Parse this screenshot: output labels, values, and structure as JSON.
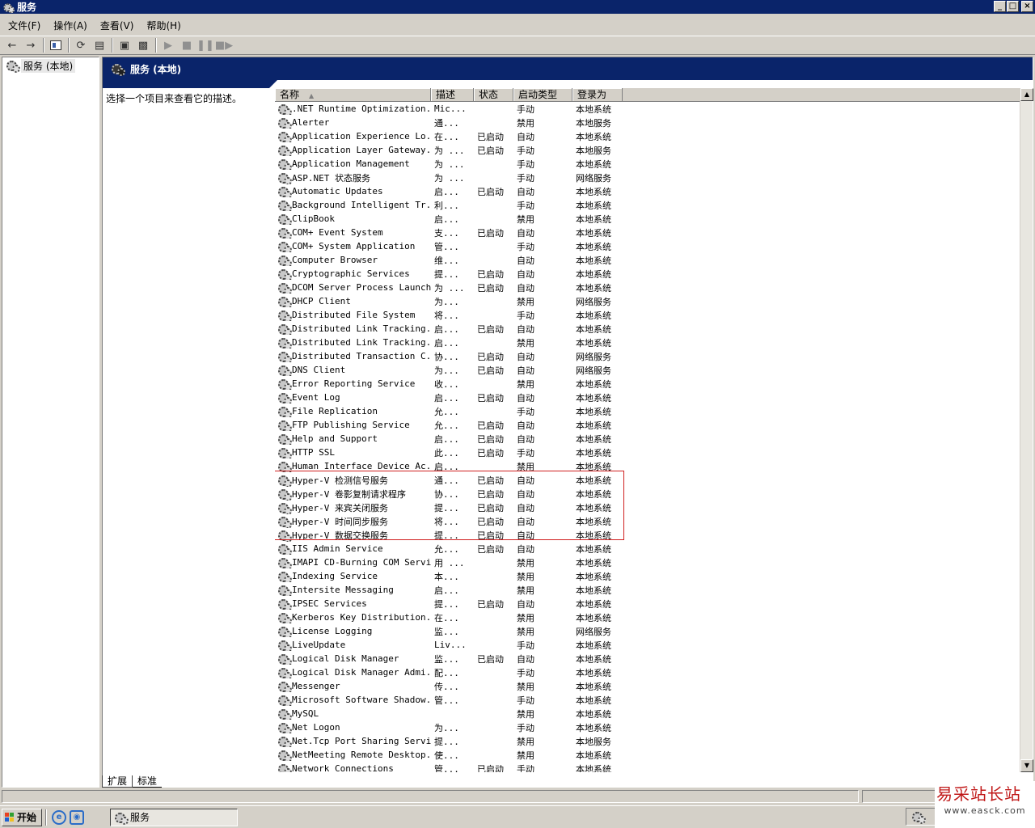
{
  "window": {
    "title": "服务",
    "min_label": "_",
    "max_label": "□",
    "close_label": "×"
  },
  "menu": [
    "文件(F)",
    "操作(A)",
    "查看(V)",
    "帮助(H)"
  ],
  "tree": {
    "root_label": "服务 (本地)"
  },
  "panel": {
    "header_title": "服务 (本地)",
    "description_prompt": "选择一个项目来查看它的描述。"
  },
  "columns": {
    "name": "名称",
    "desc": "描述",
    "status": "状态",
    "startup": "启动类型",
    "logon": "登录为"
  },
  "services": [
    {
      "name": ".NET Runtime Optimization...",
      "desc": "Mic...",
      "status": "",
      "startup": "手动",
      "logon": "本地系统"
    },
    {
      "name": "Alerter",
      "desc": "通...",
      "status": "",
      "startup": "禁用",
      "logon": "本地服务"
    },
    {
      "name": "Application Experience Lo...",
      "desc": "在...",
      "status": "已启动",
      "startup": "自动",
      "logon": "本地系统"
    },
    {
      "name": "Application Layer Gateway...",
      "desc": "为 ...",
      "status": "已启动",
      "startup": "手动",
      "logon": "本地服务"
    },
    {
      "name": "Application Management",
      "desc": "为 ...",
      "status": "",
      "startup": "手动",
      "logon": "本地系统"
    },
    {
      "name": "ASP.NET 状态服务",
      "desc": "为 ...",
      "status": "",
      "startup": "手动",
      "logon": "网络服务"
    },
    {
      "name": "Automatic Updates",
      "desc": "启...",
      "status": "已启动",
      "startup": "自动",
      "logon": "本地系统"
    },
    {
      "name": "Background Intelligent Tr...",
      "desc": "利...",
      "status": "",
      "startup": "手动",
      "logon": "本地系统"
    },
    {
      "name": "ClipBook",
      "desc": "启...",
      "status": "",
      "startup": "禁用",
      "logon": "本地系统"
    },
    {
      "name": "COM+ Event System",
      "desc": "支...",
      "status": "已启动",
      "startup": "自动",
      "logon": "本地系统"
    },
    {
      "name": "COM+ System Application",
      "desc": "管...",
      "status": "",
      "startup": "手动",
      "logon": "本地系统"
    },
    {
      "name": "Computer Browser",
      "desc": "维...",
      "status": "",
      "startup": "自动",
      "logon": "本地系统"
    },
    {
      "name": "Cryptographic Services",
      "desc": "提...",
      "status": "已启动",
      "startup": "自动",
      "logon": "本地系统"
    },
    {
      "name": "DCOM Server Process Launcher",
      "desc": "为 ...",
      "status": "已启动",
      "startup": "自动",
      "logon": "本地系统"
    },
    {
      "name": "DHCP Client",
      "desc": "为...",
      "status": "",
      "startup": "禁用",
      "logon": "网络服务"
    },
    {
      "name": "Distributed File System",
      "desc": "将...",
      "status": "",
      "startup": "手动",
      "logon": "本地系统"
    },
    {
      "name": "Distributed Link Tracking...",
      "desc": "启...",
      "status": "已启动",
      "startup": "自动",
      "logon": "本地系统"
    },
    {
      "name": "Distributed Link Tracking...",
      "desc": "启...",
      "status": "",
      "startup": "禁用",
      "logon": "本地系统"
    },
    {
      "name": "Distributed Transaction C...",
      "desc": "协...",
      "status": "已启动",
      "startup": "自动",
      "logon": "网络服务"
    },
    {
      "name": "DNS Client",
      "desc": "为...",
      "status": "已启动",
      "startup": "自动",
      "logon": "网络服务"
    },
    {
      "name": "Error Reporting Service",
      "desc": "收...",
      "status": "",
      "startup": "禁用",
      "logon": "本地系统"
    },
    {
      "name": "Event Log",
      "desc": "启...",
      "status": "已启动",
      "startup": "自动",
      "logon": "本地系统"
    },
    {
      "name": "File Replication",
      "desc": "允...",
      "status": "",
      "startup": "手动",
      "logon": "本地系统"
    },
    {
      "name": "FTP Publishing Service",
      "desc": "允...",
      "status": "已启动",
      "startup": "自动",
      "logon": "本地系统"
    },
    {
      "name": "Help and Support",
      "desc": "启...",
      "status": "已启动",
      "startup": "自动",
      "logon": "本地系统"
    },
    {
      "name": "HTTP SSL",
      "desc": "此...",
      "status": "已启动",
      "startup": "手动",
      "logon": "本地系统"
    },
    {
      "name": "Human Interface Device Ac...",
      "desc": "启...",
      "status": "",
      "startup": "禁用",
      "logon": "本地系统"
    },
    {
      "name": "Hyper-V 检测信号服务",
      "desc": "通...",
      "status": "已启动",
      "startup": "自动",
      "logon": "本地系统"
    },
    {
      "name": "Hyper-V 卷影复制请求程序",
      "desc": "协...",
      "status": "已启动",
      "startup": "自动",
      "logon": "本地系统"
    },
    {
      "name": "Hyper-V 来宾关闭服务",
      "desc": "提...",
      "status": "已启动",
      "startup": "自动",
      "logon": "本地系统"
    },
    {
      "name": "Hyper-V 时间同步服务",
      "desc": "将...",
      "status": "已启动",
      "startup": "自动",
      "logon": "本地系统"
    },
    {
      "name": "Hyper-V 数据交换服务",
      "desc": "提...",
      "status": "已启动",
      "startup": "自动",
      "logon": "本地系统"
    },
    {
      "name": "IIS Admin Service",
      "desc": "允...",
      "status": "已启动",
      "startup": "自动",
      "logon": "本地系统"
    },
    {
      "name": "IMAPI CD-Burning COM Service",
      "desc": "用 ...",
      "status": "",
      "startup": "禁用",
      "logon": "本地系统"
    },
    {
      "name": "Indexing Service",
      "desc": "本...",
      "status": "",
      "startup": "禁用",
      "logon": "本地系统"
    },
    {
      "name": "Intersite Messaging",
      "desc": "启...",
      "status": "",
      "startup": "禁用",
      "logon": "本地系统"
    },
    {
      "name": "IPSEC Services",
      "desc": "提...",
      "status": "已启动",
      "startup": "自动",
      "logon": "本地系统"
    },
    {
      "name": "Kerberos Key Distribution...",
      "desc": "在...",
      "status": "",
      "startup": "禁用",
      "logon": "本地系统"
    },
    {
      "name": "License Logging",
      "desc": "监...",
      "status": "",
      "startup": "禁用",
      "logon": "网络服务"
    },
    {
      "name": "LiveUpdate",
      "desc": "Liv...",
      "status": "",
      "startup": "手动",
      "logon": "本地系统"
    },
    {
      "name": "Logical Disk Manager",
      "desc": "监...",
      "status": "已启动",
      "startup": "自动",
      "logon": "本地系统"
    },
    {
      "name": "Logical Disk Manager Admi...",
      "desc": "配...",
      "status": "",
      "startup": "手动",
      "logon": "本地系统"
    },
    {
      "name": "Messenger",
      "desc": "传...",
      "status": "",
      "startup": "禁用",
      "logon": "本地系统"
    },
    {
      "name": "Microsoft Software Shadow...",
      "desc": "管...",
      "status": "",
      "startup": "手动",
      "logon": "本地系统"
    },
    {
      "name": "MySQL",
      "desc": "",
      "status": "",
      "startup": "禁用",
      "logon": "本地系统"
    },
    {
      "name": "Net Logon",
      "desc": "为...",
      "status": "",
      "startup": "手动",
      "logon": "本地系统"
    },
    {
      "name": "Net.Tcp Port Sharing Service",
      "desc": "提...",
      "status": "",
      "startup": "禁用",
      "logon": "本地服务"
    },
    {
      "name": "NetMeeting Remote Desktop...",
      "desc": "使...",
      "status": "",
      "startup": "禁用",
      "logon": "本地系统"
    },
    {
      "name": "Network Connections",
      "desc": "管...",
      "status": "已启动",
      "startup": "手动",
      "logon": "本地系统"
    }
  ],
  "tabs": {
    "extended": "扩展",
    "standard": "标准"
  },
  "taskbar": {
    "start_label": "开始",
    "task_label": "服务"
  },
  "watermark": {
    "line1": "易采站长站",
    "line2": "www.easck.com"
  }
}
